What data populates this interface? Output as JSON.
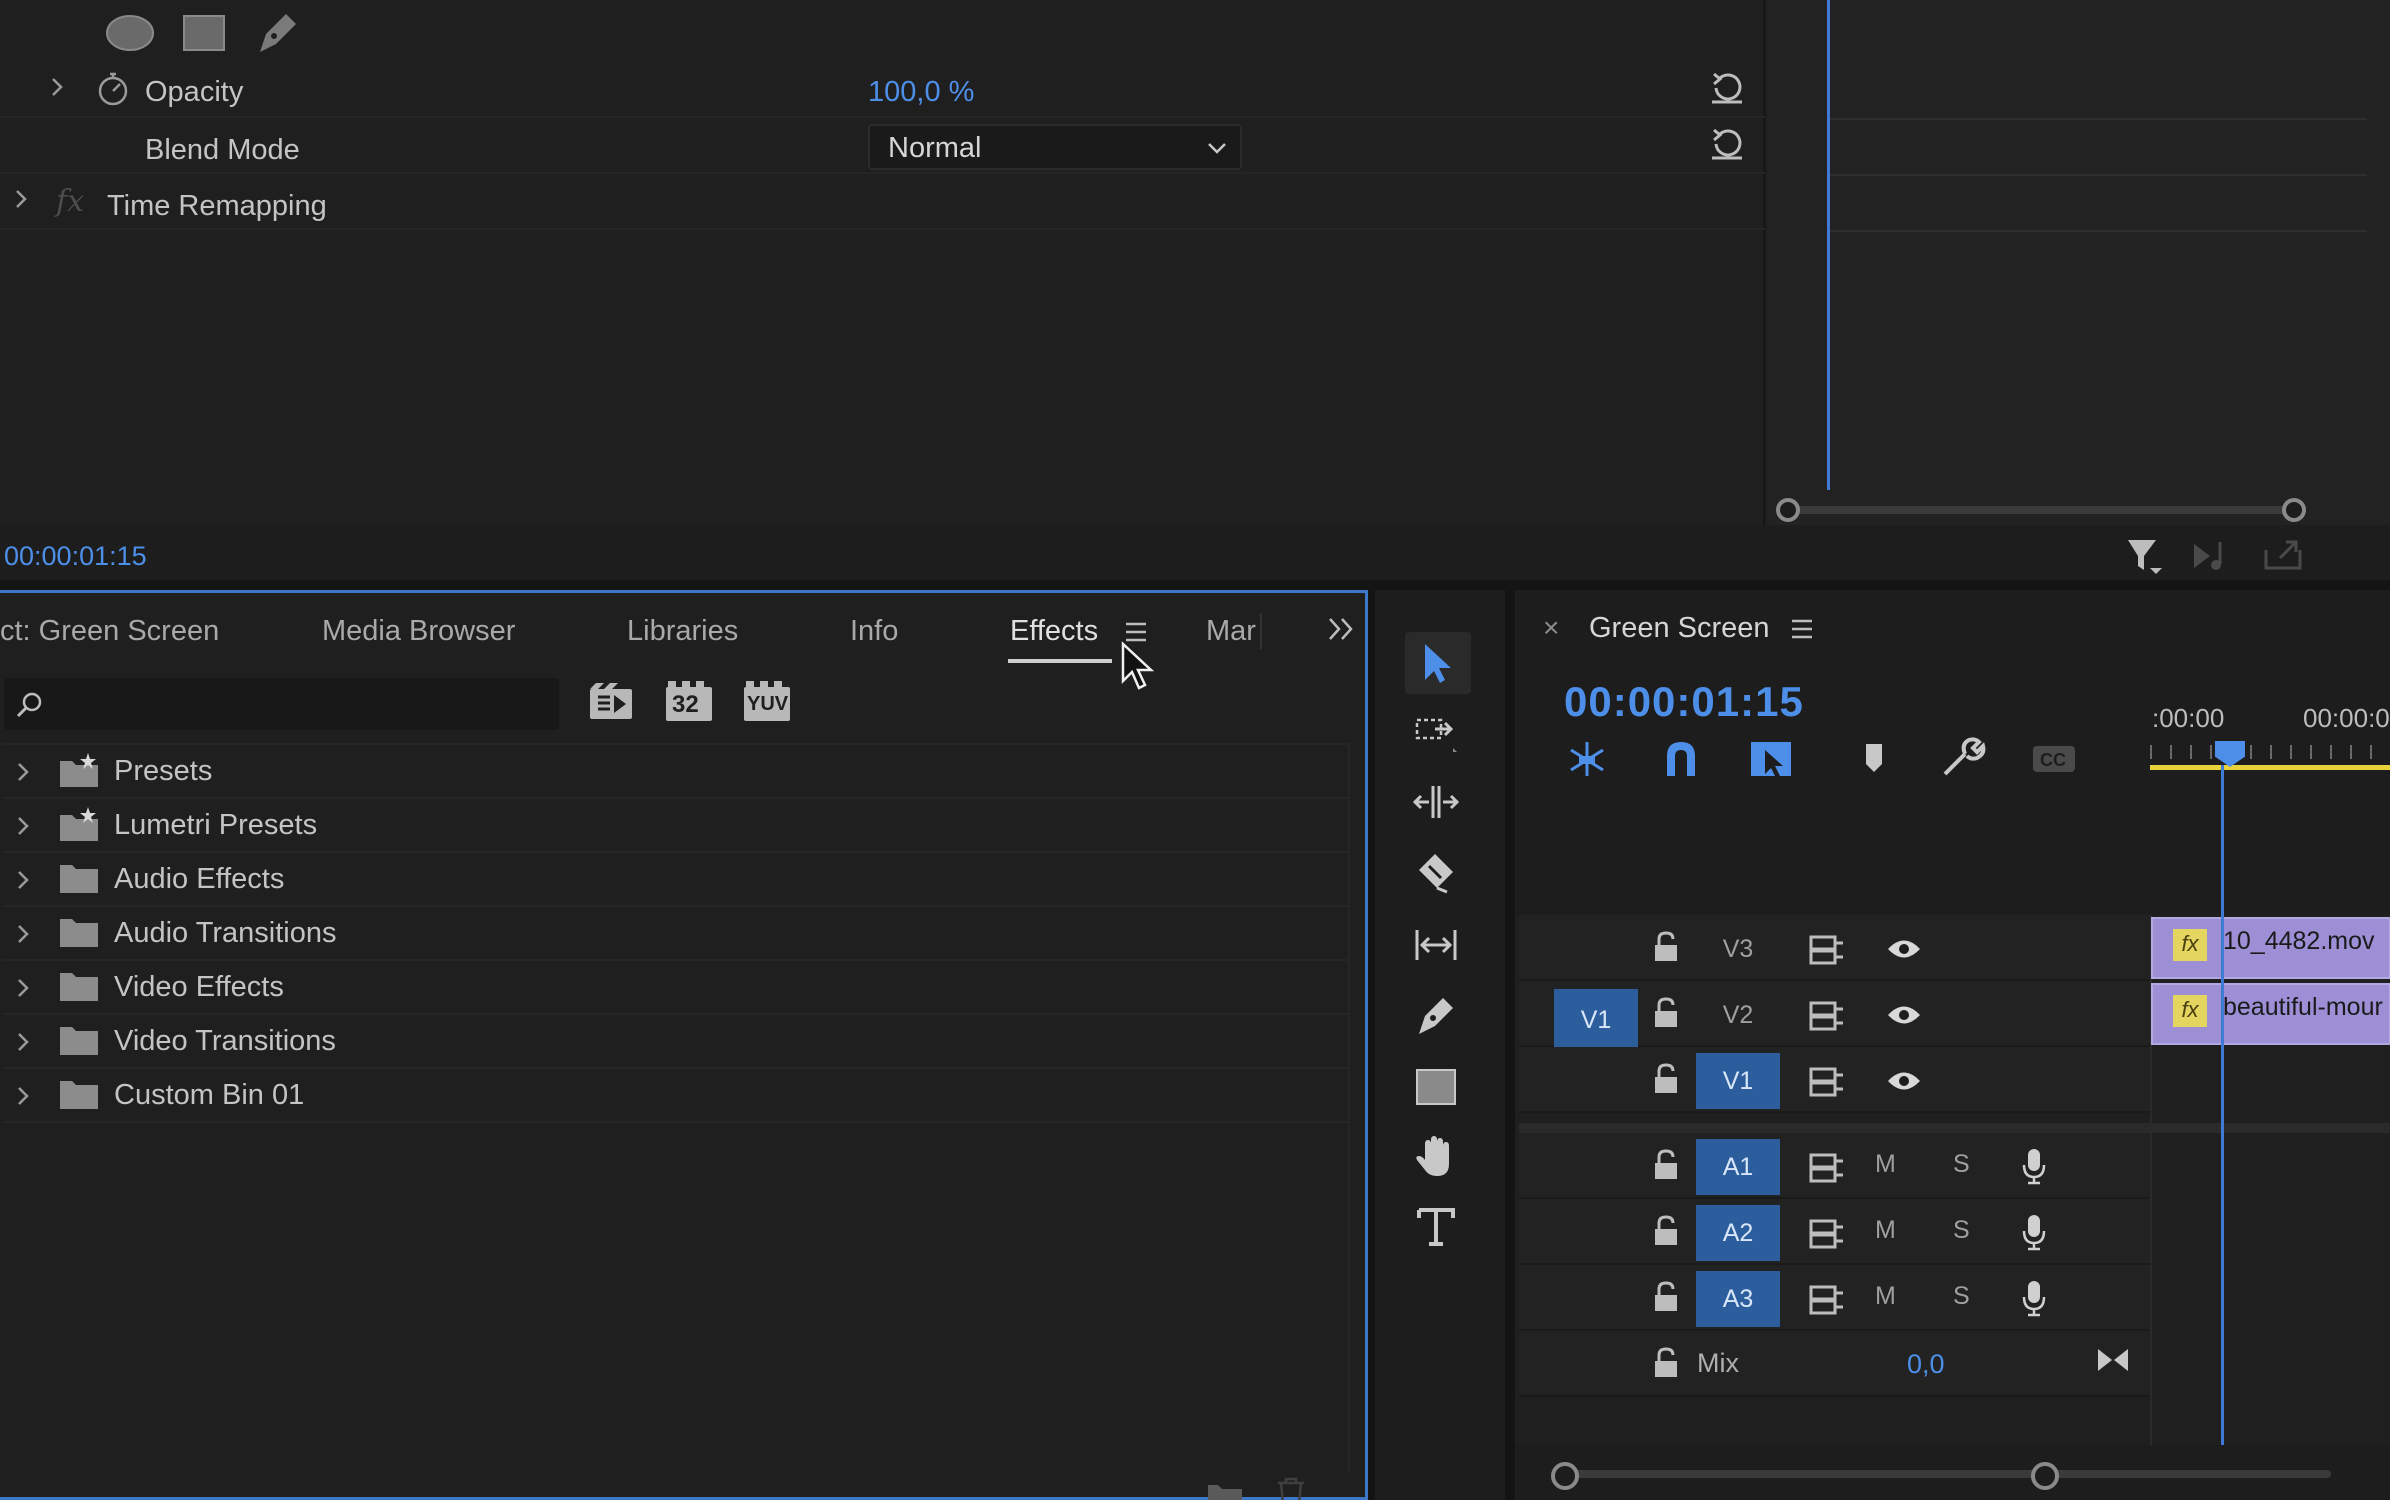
{
  "effect_controls": {
    "opacity_label": "Opacity",
    "opacity_value": "100,0 %",
    "blend_mode_label": "Blend Mode",
    "blend_mode_value": "Normal",
    "time_remapping_label": "Time Remapping",
    "fx_glyph": "fx",
    "timecode": "00:00:01:15",
    "mask_tools": [
      "ellipse-icon",
      "rectangle-icon",
      "pen-icon"
    ]
  },
  "effects_panel": {
    "tabs": [
      "ct: Green Screen",
      "Media Browser",
      "Libraries",
      "Info",
      "Effects",
      "Mar"
    ],
    "active_tab": "Effects",
    "search": {
      "placeholder": "",
      "value": ""
    },
    "filter_buttons": [
      "accelerated-effects-icon",
      "32",
      "YUV"
    ],
    "bins": [
      {
        "label": "Presets",
        "icon": "preset-folder-icon"
      },
      {
        "label": "Lumetri Presets",
        "icon": "preset-folder-icon"
      },
      {
        "label": "Audio Effects",
        "icon": "folder-icon"
      },
      {
        "label": "Audio Transitions",
        "icon": "folder-icon"
      },
      {
        "label": "Video Effects",
        "icon": "folder-icon"
      },
      {
        "label": "Video Transitions",
        "icon": "folder-icon"
      },
      {
        "label": "Custom Bin 01",
        "icon": "folder-icon"
      }
    ]
  },
  "tools": [
    "selection-tool",
    "track-select-forward-tool",
    "ripple-edit-tool",
    "razor-tool",
    "slip-tool",
    "pen-tool",
    "rectangle-tool",
    "hand-tool",
    "type-tool"
  ],
  "timeline": {
    "close_glyph": "×",
    "title": "Green Screen",
    "timecode": "00:00:01:15",
    "ruler_labels": [
      ":00:00",
      "00:00:0"
    ],
    "tracks": {
      "v3": "V3",
      "v2": "V2",
      "v1": "V1",
      "v1_source": "V1",
      "a1": "A1",
      "a2": "A2",
      "a3": "A3",
      "mute": "M",
      "solo": "S",
      "mix_label": "Mix",
      "mix_value": "0,0"
    },
    "clips": [
      {
        "name": "10_4482.mov",
        "fx": "fx"
      },
      {
        "name": "beautiful-mour",
        "fx": "fx"
      }
    ],
    "colors": {
      "accent": "#4d8fe8",
      "clip": "#9d8fd6",
      "track_highlight": "#2c5e9e",
      "work_area": "#e8d23a"
    }
  }
}
